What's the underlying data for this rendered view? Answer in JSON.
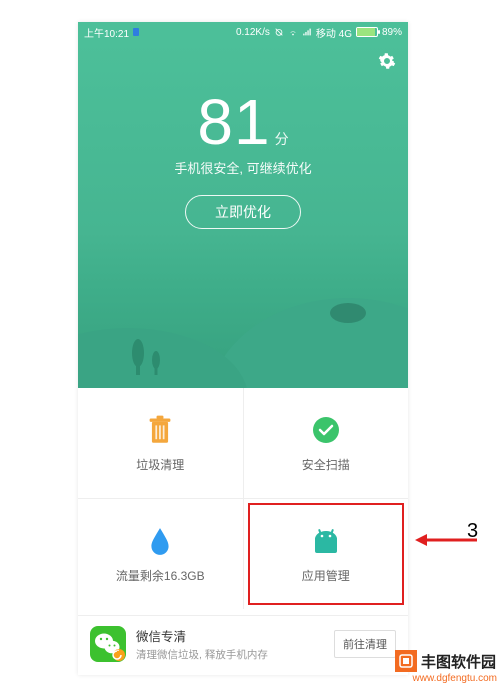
{
  "statusbar": {
    "time": "上午10:21",
    "net_speed": "0.12K/s",
    "carrier": "移动 4G",
    "battery_pct": "89%"
  },
  "hero": {
    "score": "81",
    "score_unit": "分",
    "subtitle": "手机很安全, 可继续优化",
    "optimize_label": "立即优化"
  },
  "grid": {
    "trash_label": "垃圾清理",
    "scan_label": "安全扫描",
    "data_label": "流量剩余16.3GB",
    "apps_label": "应用管理"
  },
  "promo": {
    "title": "微信专清",
    "desc": "清理微信垃圾, 释放手机内存",
    "action": "前往清理"
  },
  "annotation": {
    "number": "3"
  },
  "watermark": {
    "brand": "丰图软件园",
    "url": "www.dgfengtu.com"
  },
  "colors": {
    "hero_green": "#4cbf99",
    "trash_orange": "#f4a73d",
    "scan_green": "#3bc46b",
    "data_blue": "#2f9bf0",
    "apps_teal": "#2bb8a3",
    "highlight_red": "#e02020",
    "wm_orange": "#f36b21"
  }
}
